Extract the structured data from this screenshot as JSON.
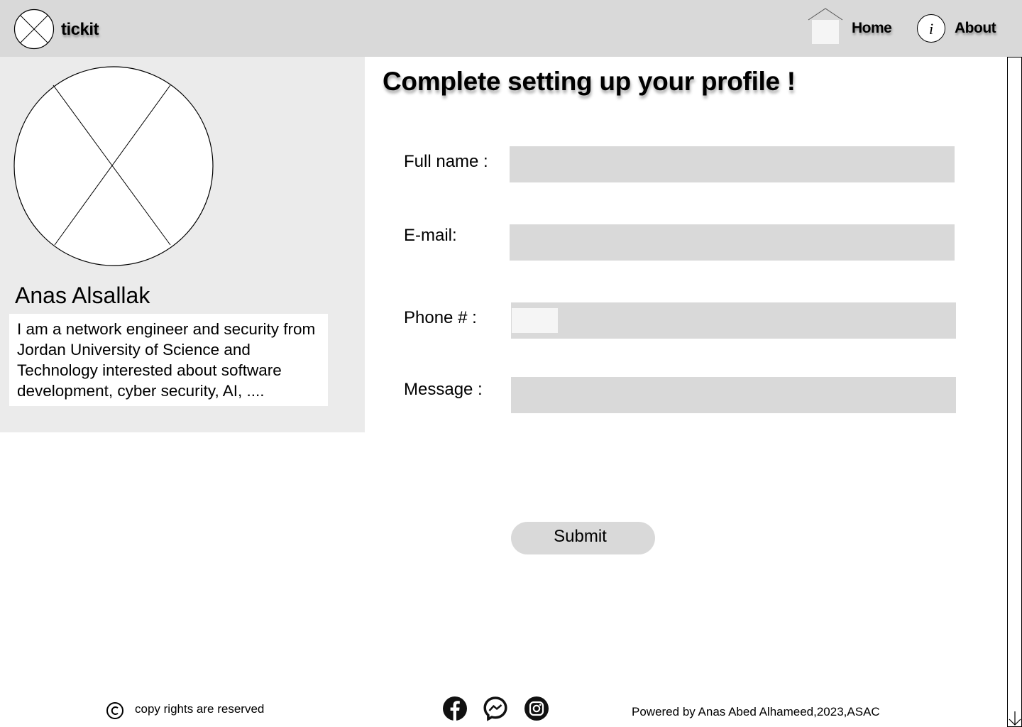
{
  "header": {
    "brand": "tickit",
    "logo_icon": "placeholder-x-icon",
    "nav": [
      {
        "label": "Home",
        "icon": "home-icon"
      },
      {
        "label": "About",
        "icon": "info-icon"
      }
    ]
  },
  "profile": {
    "avatar_icon": "placeholder-x-icon",
    "name": "Anas Alsallak",
    "bio": "I am a network engineer and security from Jordan University of Science and Technology interested about software development, cyber security, AI, ...."
  },
  "main": {
    "title": "Complete setting up your profile !",
    "form": {
      "full_name_label": "Full name :",
      "full_name_value": "",
      "email_label": "E-mail:",
      "email_value": "",
      "phone_label": "Phone # :",
      "phone_value": "",
      "message_label": "Message :",
      "message_value": "",
      "submit_label": "Submit"
    }
  },
  "footer": {
    "copyright_icon": "copyright-icon",
    "copyright_text": "copy rights are reserved",
    "social": [
      "facebook-icon",
      "messenger-icon",
      "instagram-icon"
    ],
    "powered_by": "Powered by Anas Abed Alhameed,2023,ASAC"
  },
  "colors": {
    "header_bg": "#d9d9d9",
    "panel_bg": "#ebebeb",
    "input_bg": "#d9d9d9",
    "button_bg": "#d9d9d9"
  }
}
